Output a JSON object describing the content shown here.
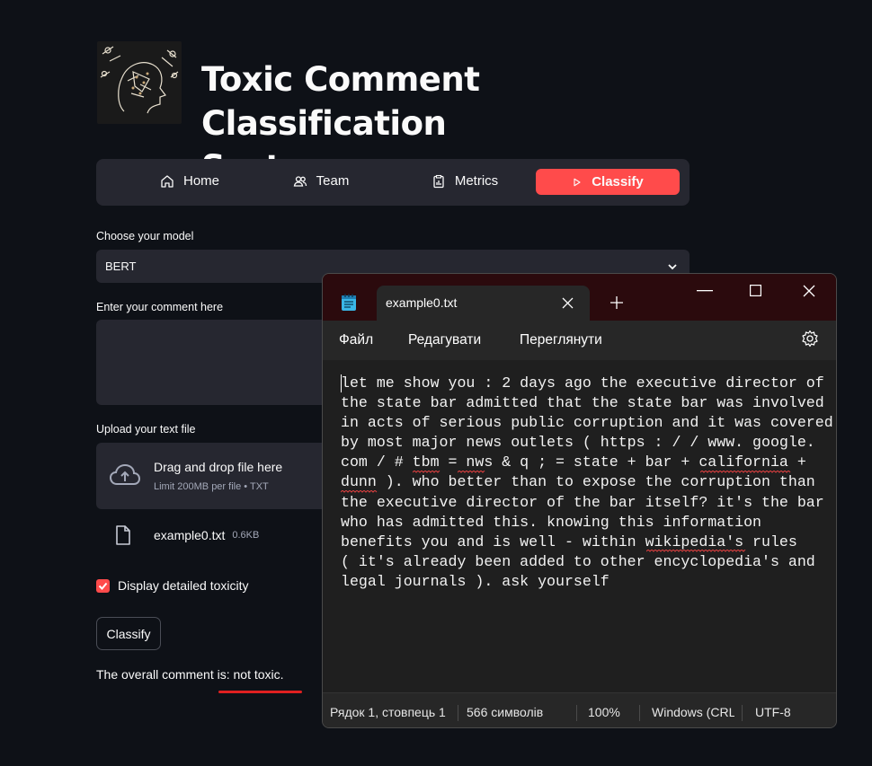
{
  "app": {
    "title": "Toxic Comment Classification System",
    "title_line1": "Toxic Comment Classification",
    "title_line2": "System",
    "logo_icon": "ai-head-illustration"
  },
  "nav": {
    "items": [
      {
        "label": "Home",
        "icon": "home-icon"
      },
      {
        "label": "Team",
        "icon": "team-icon"
      },
      {
        "label": "Metrics",
        "icon": "clipboard-icon"
      },
      {
        "label": "Classify",
        "icon": "play-icon",
        "active": true
      }
    ]
  },
  "model_select": {
    "label": "Choose your model",
    "value": "BERT"
  },
  "comment_input": {
    "label": "Enter your comment here",
    "value": ""
  },
  "upload": {
    "label": "Upload your text file",
    "title": "Drag and drop file here",
    "subtitle": "Limit 200MB per file • TXT",
    "file_name": "example0.txt",
    "file_size": "0.6KB"
  },
  "detailed_toxicity": {
    "label": "Display detailed toxicity",
    "checked": true
  },
  "classify_button": {
    "label": "Classify"
  },
  "result": {
    "text": "The overall comment is: not toxic."
  },
  "notepad": {
    "tab_title": "example0.txt",
    "menu": [
      "Файл",
      "Редагувати",
      "Переглянути"
    ],
    "content_lines": [
      "let me show you : 2 days ago the executive director of",
      "the state bar admitted that the state bar was involved",
      "in acts of serious public corruption and it was covered",
      "by most major news outlets ( https : / / www. google.",
      "com / # tbm = nws & q ; = state + bar + california +",
      "dunn ). who better than to expose the corruption than",
      "the executive director of the bar itself? it's the bar",
      "who has admitted this. knowing this information",
      "benefits you and is well - within wikipedia's rules",
      "( it's already been added to other encyclopedia's and",
      "legal journals ). ask yourself"
    ],
    "status": {
      "position": "Рядок 1, стовпець 1",
      "chars": "566 символів",
      "zoom": "100%",
      "line_ending": "Windows (CRLF)",
      "encoding": "UTF-8"
    }
  },
  "colors": {
    "background": "#0e1117",
    "surface": "#262730",
    "accent": "#ff4b4b",
    "notepad_titlebar": "#2b0a0d",
    "annotation_red": "#e02020"
  }
}
